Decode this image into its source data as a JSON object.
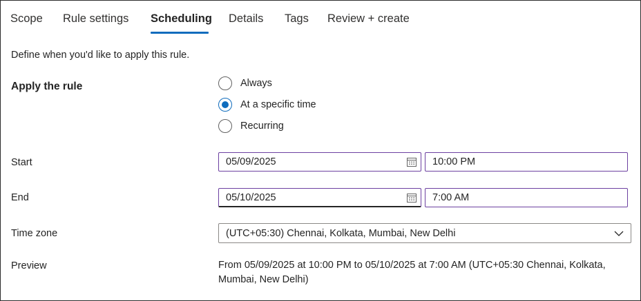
{
  "tabs": [
    {
      "label": "Scope"
    },
    {
      "label": "Rule settings"
    },
    {
      "label": "Scheduling"
    },
    {
      "label": "Details"
    },
    {
      "label": "Tags"
    },
    {
      "label": "Review + create"
    }
  ],
  "active_tab": "Scheduling",
  "accent_color": "#0f6cbd",
  "focus_border_color": "#6b3fa0",
  "intro_text": "Define when you'd like to apply this rule.",
  "apply_rule": {
    "label": "Apply the rule",
    "options": [
      {
        "label": "Always",
        "selected": false
      },
      {
        "label": "At a specific time",
        "selected": true
      },
      {
        "label": "Recurring",
        "selected": false
      }
    ]
  },
  "start": {
    "label": "Start",
    "date": "05/09/2025",
    "time": "10:00 PM",
    "date_icon": "calendar-icon"
  },
  "end": {
    "label": "End",
    "date": "05/10/2025",
    "time": "7:00 AM",
    "date_icon": "calendar-icon"
  },
  "time_zone": {
    "label": "Time zone",
    "value": "(UTC+05:30) Chennai, Kolkata, Mumbai, New Delhi",
    "icon": "chevron-down-icon"
  },
  "preview": {
    "label": "Preview",
    "text": "From 05/09/2025 at 10:00 PM to 05/10/2025 at 7:00 AM (UTC+05:30 Chennai, Kolkata, Mumbai, New Delhi)"
  }
}
